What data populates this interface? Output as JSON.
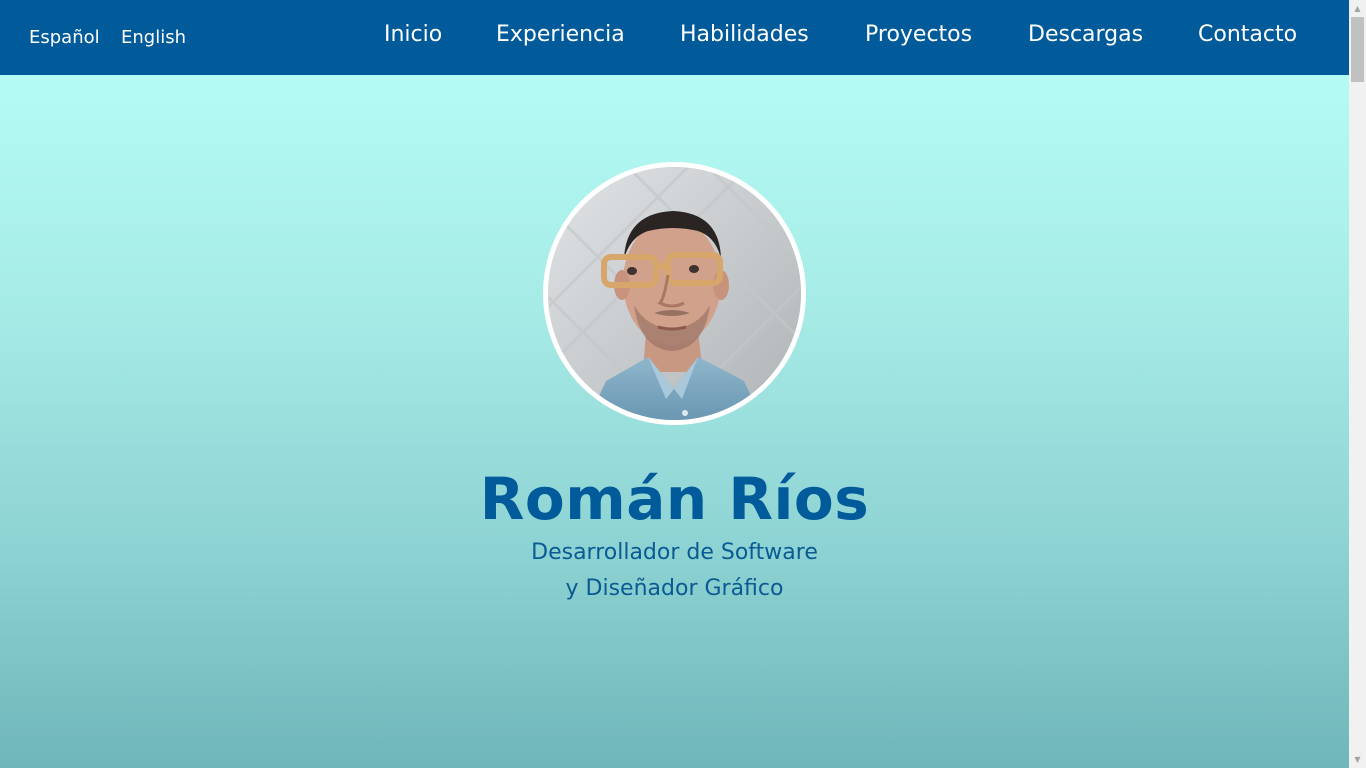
{
  "header": {
    "languages": [
      {
        "label": "Español"
      },
      {
        "label": "English"
      }
    ],
    "nav": [
      {
        "label": "Inicio"
      },
      {
        "label": "Experiencia"
      },
      {
        "label": "Habilidades"
      },
      {
        "label": "Proyectos"
      },
      {
        "label": "Descargas"
      },
      {
        "label": "Contacto"
      }
    ]
  },
  "hero": {
    "name": "Román Ríos",
    "subtitle_line1": "Desarrollador de Software",
    "subtitle_line2": "y Diseñador Gráfico"
  },
  "colors": {
    "navbar": "#015a9a",
    "accent": "#015a9a",
    "background_top": "#b8fff8",
    "background_bottom": "#6fb6ba"
  },
  "icons": {
    "scroll_up": "arrow-up-icon",
    "scroll_down": "arrow-down-icon"
  }
}
